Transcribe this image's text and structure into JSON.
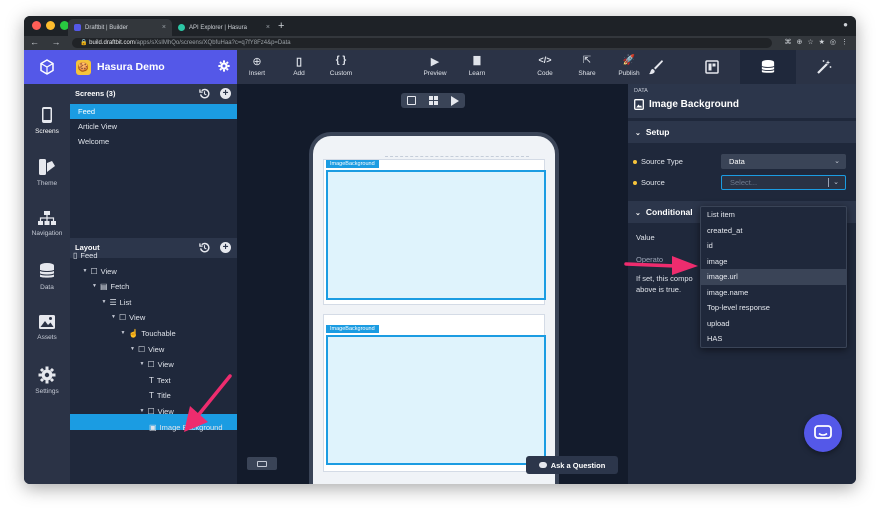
{
  "browser": {
    "tabs": [
      {
        "title": "Draftbit | Builder",
        "close": "×",
        "favicon_color": "#5458e8"
      },
      {
        "title": "API Explorer | Hasura",
        "close": "×",
        "favicon_color": "#2cc6a5"
      }
    ],
    "new_tab": "+",
    "menu": "●",
    "nav": "← → C",
    "url_domain": "build.draftbit.com",
    "url_path": "/apps/sXsIMhQo/screens/XQbfuHaa?c=q7fY8Fz4&p=Data",
    "ext_icons": [
      "⌘",
      "⊕",
      "☆",
      "★",
      "◎",
      "⋮"
    ]
  },
  "project": {
    "name": "Hasura Demo",
    "icon": "🍪"
  },
  "rail": [
    {
      "label": "Screens",
      "icon": "phone-icon"
    },
    {
      "label": "Theme",
      "icon": "palette-icon"
    },
    {
      "label": "Navigation",
      "icon": "sitemap-icon"
    },
    {
      "label": "Data",
      "icon": "database-icon"
    },
    {
      "label": "Assets",
      "icon": "image-icon"
    },
    {
      "label": "Settings",
      "icon": "gear-icon"
    }
  ],
  "screens": {
    "header": "Screens (3)",
    "items": [
      "Feed",
      "Article View",
      "Welcome"
    ],
    "selected": "Feed"
  },
  "layout": {
    "header": "Layout",
    "tree": [
      {
        "label": "Feed",
        "depth": 0,
        "caret": "",
        "icon": "▯"
      },
      {
        "label": "View",
        "depth": 1,
        "caret": "▼",
        "icon": "☐"
      },
      {
        "label": "Fetch",
        "depth": 2,
        "caret": "▼",
        "icon": "▤"
      },
      {
        "label": "List",
        "depth": 3,
        "caret": "▼",
        "icon": "☰"
      },
      {
        "label": "View",
        "depth": 4,
        "caret": "▼",
        "icon": "☐"
      },
      {
        "label": "Touchable",
        "depth": 5,
        "caret": "▼",
        "icon": "☝"
      },
      {
        "label": "View",
        "depth": 6,
        "caret": "▼",
        "icon": "☐"
      },
      {
        "label": "View",
        "depth": 7,
        "caret": "▼",
        "icon": "☐"
      },
      {
        "label": "Text",
        "depth": 8,
        "caret": "",
        "icon": "T"
      },
      {
        "label": "Title",
        "depth": 8,
        "caret": "",
        "icon": "T"
      },
      {
        "label": "View",
        "depth": 7,
        "caret": "▼",
        "icon": "☐"
      },
      {
        "label": "Image Background",
        "depth": 8,
        "caret": "",
        "icon": "▣"
      }
    ]
  },
  "toolbar": {
    "left": [
      {
        "label": "Insert",
        "glyph": "⊕"
      },
      {
        "label": "Add",
        "glyph": "▯"
      },
      {
        "label": "Custom",
        "glyph": "{ }"
      }
    ],
    "middle": [
      {
        "label": "Preview",
        "glyph": "▶"
      },
      {
        "label": "Learn",
        "glyph": "▇"
      }
    ],
    "right": [
      {
        "label": "Code",
        "glyph": "</>"
      },
      {
        "label": "Share",
        "glyph": "⇱"
      },
      {
        "label": "Publish",
        "glyph": "🚀"
      }
    ],
    "panel_tabs": [
      "brush-icon",
      "layout-icon",
      "database-icon",
      "magic-wand-icon"
    ]
  },
  "canvas": {
    "cards": [
      {
        "tag": "ImageBackground"
      },
      {
        "tag": "ImageBackground"
      }
    ],
    "ask_label": "Ask a Question"
  },
  "props": {
    "kicker": "DATA",
    "title": "Image Background",
    "setup_header": "Setup",
    "source_type_label": "Source Type",
    "source_type_value": "Data",
    "source_label": "Source",
    "source_placeholder": "Select...",
    "conditional_header": "Conditional",
    "value_label": "Value",
    "operator_label": "Operato",
    "help_text_1": "If set, this compo",
    "help_text_2": "above is true."
  },
  "dropdown": {
    "options": [
      "List item",
      "created_at",
      "id",
      "image",
      "image.url",
      "image.name",
      "Top-level response",
      "upload",
      "HAS"
    ],
    "highlighted": "image.url"
  },
  "colors": {
    "accent": "#5458e8",
    "selection": "#1b9ce2",
    "annotation_arrow": "#ee2c6e"
  }
}
